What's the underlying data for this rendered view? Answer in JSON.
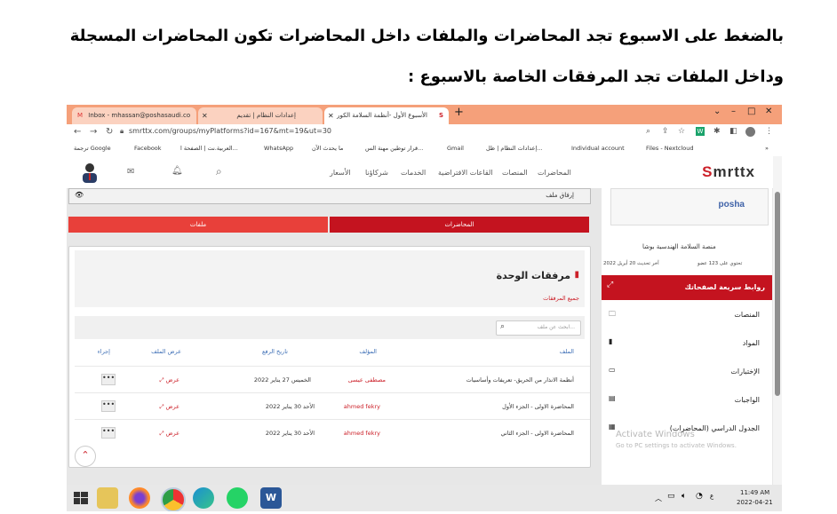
{
  "caption": {
    "line1": "بالضغط على الاسبوع تجد المحاضرات والملفات داخل المحاضرات تكون المحاضرات المسجلة",
    "line2": "وداخل الملفات تجد المرفقات الخاصة بالاسبوع :"
  },
  "browser": {
    "tabs": [
      {
        "label": "Inbox - mhassan@poshasaudi.co"
      },
      {
        "label": "إعدادات النظام | تقديم"
      },
      {
        "label": "الأسبوع الأول -أنظمة السلامة الكور"
      }
    ],
    "new_tab": "+",
    "url": "smrttx.com/groups/myPlatforms?id=167&mt=19&ut=30",
    "bookmarks": [
      "ترجمة Google",
      "Facebook",
      "العربية.نت | الصفحة ا...",
      "WhatsApp",
      "ما يحدث الآن",
      "قرار توطين مهنة الس...",
      "Gmail",
      "إعدادات النظام | ظل...",
      "Individual account",
      "Files - Nextcloud"
    ]
  },
  "site": {
    "logo_main": "mrttx",
    "logo_s": "S",
    "menu": [
      "المحاضرات",
      "المنصات",
      "القاعات الافتراضية",
      "الخدمات",
      "شركاؤنا",
      "الأسعار"
    ],
    "attach_label": "إرفاق ملف",
    "buttons": {
      "lectures": "المحاضرات",
      "files": "ملفات"
    },
    "attachments_title": "مرفقات الوحدة",
    "all_attachments": "جميع المرفقات",
    "search_placeholder": "ابحث عن ملف...",
    "table": {
      "headers": [
        "الملف",
        "المؤلف",
        "تاريخ الرفع",
        "عرض الملف",
        "إجراء"
      ],
      "rows": [
        {
          "file": "أنظمة الانذار من الحريق- تعريفات وأساسيات",
          "author": "مصطفى عيسى",
          "date": "الخميس 27 يناير 2022",
          "view": "عرض",
          "action": "•••"
        },
        {
          "file": "المحاضرة الاولى - الجزء الأول",
          "author": "ahmed fekry",
          "date": "الأحد 30 يناير 2022",
          "view": "عرض",
          "action": "•••"
        },
        {
          "file": "المحاضرة الاولى - الجزء الثاني",
          "author": "ahmed fekry",
          "date": "الأحد 30 يناير 2022",
          "view": "عرض",
          "action": "•••"
        }
      ]
    },
    "side": {
      "logo_text": "posha",
      "platform_name": "منصة السلامة الهندسية بوشا",
      "members": "تحتوي على 123 عضو",
      "updated": "آخر تحديث 20 أبريل 2022",
      "quick_links_title": "روابط سريعة لصفحاتك",
      "links": [
        "المنصات",
        "المواد",
        "الإختبارات",
        "الواجبات",
        "الجدول الدراسي (المحاضرات)"
      ]
    },
    "watermark": {
      "line1": "Activate Windows",
      "line2": "Go to PC settings to activate Windows."
    }
  },
  "taskbar": {
    "time": "11:49 AM",
    "date": "2022-04-21"
  },
  "colors": {
    "brand_red": "#cc2029",
    "tabbar": "#f5a07a",
    "red_button": "#e8403a"
  }
}
